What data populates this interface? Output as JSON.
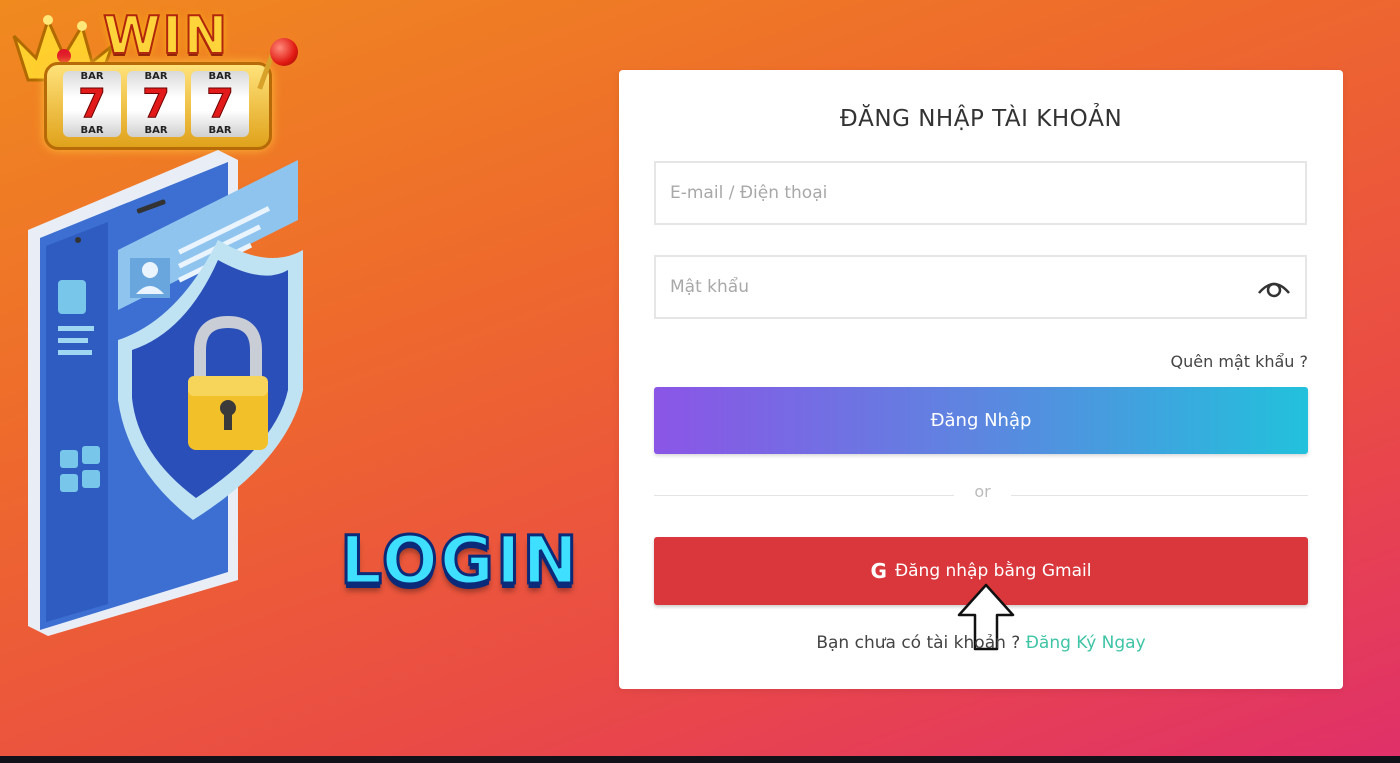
{
  "brand": {
    "logo_word": "WIN",
    "slot_reels": [
      {
        "top": "BAR",
        "symbol": "7",
        "bottom": "BAR"
      },
      {
        "top": "BAR",
        "symbol": "7",
        "bottom": "BAR"
      },
      {
        "top": "BAR",
        "symbol": "7",
        "bottom": "BAR"
      }
    ]
  },
  "hero": {
    "login_word": "LOGIN"
  },
  "form": {
    "title": "ĐĂNG NHẬP TÀI KHOẢN",
    "email_placeholder": "E-mail / Điện thoại",
    "password_placeholder": "Mật khẩu",
    "forgot_label": "Quên mật khẩu ?",
    "submit_label": "Đăng Nhập",
    "or_label": "or",
    "gmail_icon": "G",
    "gmail_label": "Đăng nhập bằng Gmail",
    "no_account_text": "Bạn chưa có tài khoản ?",
    "register_label": "Đăng Ký Ngay"
  },
  "colors": {
    "login_gradient_start": "#8b55e6",
    "login_gradient_end": "#22c1dc",
    "gmail_button": "#d9373b",
    "register_link": "#3fc4a6"
  },
  "icons": [
    "crown-icon",
    "eye-icon",
    "google-icon",
    "lock-icon",
    "user-icon",
    "arrow-up-cursor-icon"
  ]
}
